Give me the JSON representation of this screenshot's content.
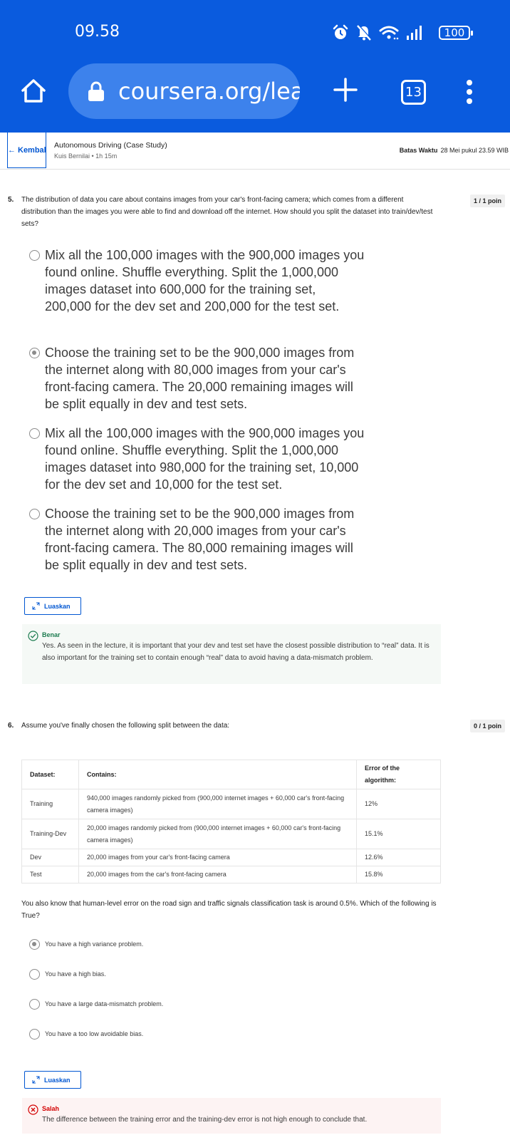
{
  "status_bar": {
    "time": "09.58",
    "battery": "100"
  },
  "browser": {
    "url": "coursera.org/lear",
    "tab_count": "13"
  },
  "course": {
    "back_label": "Kembali",
    "title": "Autonomous Driving (Case Study)",
    "subtitle": "Kuis Bernilai • 1h 15m",
    "deadline_label": "Batas Waktu",
    "deadline_value": "28 Mei pukul 23.59 WIB"
  },
  "q5": {
    "number": "5.",
    "text": "The distribution of data you care about contains images from your car's front-facing camera; which comes from a different distribution than the images you were able to find and download off the internet. How should you split the dataset into train/dev/test sets?",
    "points": "1 / 1 poin",
    "options": [
      {
        "text": "Mix all the 100,000 images with the 900,000 images you found online. Shuffle everything. Split the 1,000,000 images dataset into 600,000 for the training set, 200,000 for the dev set and 200,000 for the test set.",
        "selected": false
      },
      {
        "text": "Choose the training set to be the 900,000 images from the internet along with 80,000 images from your car's front-facing camera. The 20,000 remaining images will be split equally in dev and test sets.",
        "selected": true
      },
      {
        "text": "Mix all the 100,000 images with the 900,000 images you found online. Shuffle everything. Split the 1,000,000 images dataset into 980,000 for the training set, 10,000 for the dev set and 10,000 for the test set.",
        "selected": false
      },
      {
        "text": "Choose the training set to be the 900,000 images from the internet along with 20,000 images from your car's front-facing camera. The 80,000 remaining images will be split equally in dev and test sets.",
        "selected": false
      }
    ],
    "expand_label": "Luaskan",
    "feedback": {
      "status": "Benar",
      "text": "Yes. As seen in the lecture, it is important that your dev and test set have the closest possible distribution to “real” data. It is also important for the training set to contain enough “real” data to avoid having a data-mismatch problem."
    }
  },
  "q6": {
    "number": "6.",
    "text": "Assume you've finally chosen the following split between the data:",
    "points": "0 / 1 poin",
    "table": {
      "headers": [
        "Dataset:",
        "Contains:",
        "Error of the algorithm:"
      ],
      "rows": [
        [
          "Training",
          "940,000 images randomly picked from (900,000 internet images + 60,000 car's front-facing camera images)",
          "12%"
        ],
        [
          "Training-Dev",
          "20,000 images randomly picked from (900,000 internet images + 60,000 car's front-facing camera images)",
          "15.1%"
        ],
        [
          "Dev",
          "20,000 images from your car's front-facing camera",
          "12.6%"
        ],
        [
          "Test",
          "20,000 images from the car's front-facing camera",
          "15.8%"
        ]
      ]
    },
    "followup": "You also know that human-level error on the road sign and traffic signals classification task is around 0.5%. Which of the following is True?",
    "options": [
      {
        "text": "You have a high variance problem.",
        "selected": true
      },
      {
        "text": "You have a high bias.",
        "selected": false
      },
      {
        "text": "You have a large data-mismatch problem.",
        "selected": false
      },
      {
        "text": "You have a too low avoidable bias.",
        "selected": false
      }
    ],
    "expand_label": "Luaskan",
    "feedback": {
      "status": "Salah",
      "text": "The difference between the training error and the training-dev error is not high enough to conclude that."
    }
  },
  "colors": {
    "chrome_blue": "#0a5bde",
    "url_pill": "#3d82ec",
    "link_blue": "#0056d2",
    "correct_green": "#1d7c50",
    "wrong_red": "#d30001"
  },
  "icons": [
    "home-icon",
    "lock-icon",
    "plus-icon",
    "more-vert-icon",
    "alarm-icon",
    "bell-off-icon",
    "wifi-icon",
    "signal-icon",
    "expand-icon",
    "check-circle-icon",
    "x-circle-icon"
  ]
}
